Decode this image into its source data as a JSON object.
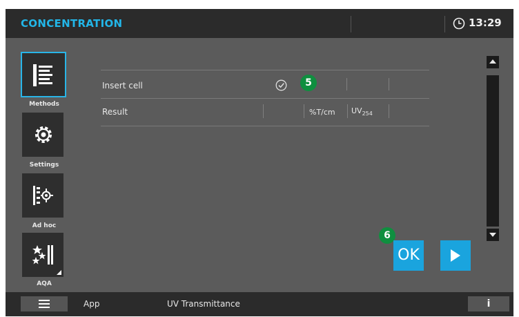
{
  "header": {
    "title": "CONCENTRATION",
    "time": "13:29"
  },
  "sidebar": {
    "items": [
      {
        "label": "Methods",
        "icon": "methods-icon",
        "active": true
      },
      {
        "label": "Settings",
        "icon": "gear-icon",
        "active": false
      },
      {
        "label": "Ad hoc",
        "icon": "adhoc-icon",
        "active": false
      },
      {
        "label": "AQA",
        "icon": "aqa-icon",
        "active": false
      }
    ]
  },
  "main": {
    "rows": [
      {
        "label": "Insert cell",
        "status_icon": "check-circle-icon"
      },
      {
        "label": "Result",
        "unit1": "%T/cm",
        "unit2_main": "UV",
        "unit2_sub": "254"
      }
    ]
  },
  "annotations": {
    "badge_5": "5",
    "badge_6": "6"
  },
  "buttons": {
    "ok_label": "OK",
    "play_icon": "play-icon",
    "scroll_up_icon": "arrow-up-icon",
    "scroll_down_icon": "arrow-down-icon"
  },
  "footer": {
    "menu_icon": "hamburger-menu-icon",
    "app_label": "App",
    "method_name": "UV Transmittance",
    "info_label": "i"
  },
  "colors": {
    "accent": "#1aa4de",
    "title": "#22b6e8",
    "badge": "#0f8f3f",
    "panel": "#5b5b5b",
    "bar": "#2b2b2b"
  }
}
